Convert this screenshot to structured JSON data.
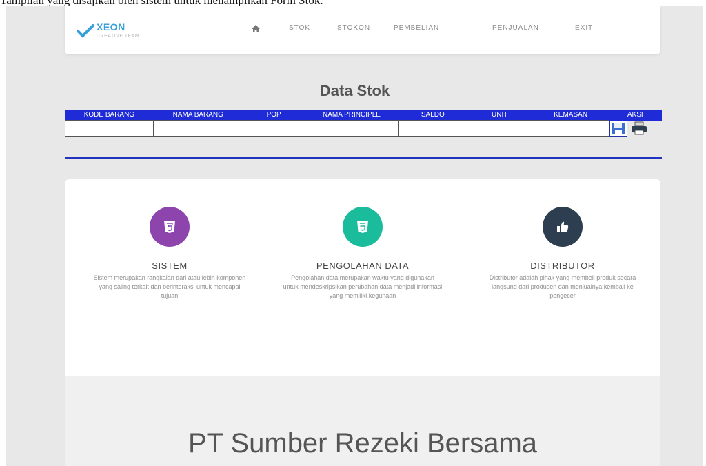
{
  "caption": "Tampilan yang disajikan oleh sistem untuk menampilkan Form Stok.",
  "brand": {
    "name": "XEON",
    "subtitle": "CREATIVE TEAM"
  },
  "nav": {
    "items": [
      "STOK",
      "STOKON",
      "PEMBELIAN",
      "PENJUALAN",
      "EXIT"
    ],
    "home_icon": "home-icon"
  },
  "stok": {
    "title": "Data Stok",
    "columns": [
      "KODE BARANG",
      "NAMA BARANG",
      "POP",
      "NAMA PRINCIPLE",
      "SALDO",
      "UNIT",
      "KEMASAN",
      "AKSI"
    ],
    "row": [
      "",
      "",
      "",
      "",
      "",
      "",
      ""
    ],
    "actions": [
      "floppy-icon",
      "printer-icon"
    ]
  },
  "features": [
    {
      "icon": "html5-icon",
      "color": "#8e44ad",
      "title": "SISTEM",
      "desc": "Sistem merupakan rangkaian dari atau lebih komponen yang saling terkait dan berinteraksi untuk mencapai tujuan"
    },
    {
      "icon": "css3-icon",
      "color": "#1abc9c",
      "title": "PENGOLAHAN DATA",
      "desc": "Pengolahan data merupakan waktu yang digunakan untuk mendeskripsikan perubahan data menjadi informasi yang memiliki kegunaan"
    },
    {
      "icon": "thumbs-up-icon",
      "color": "#2c3e50",
      "title": "DISTRIBUTOR",
      "desc": "Distributor adalah pihak yang membeli produk secara langsung dari produsen dan menjualnya kembali ke pengecer"
    }
  ],
  "company": {
    "name": "PT Sumber Rezeki Bersama"
  }
}
